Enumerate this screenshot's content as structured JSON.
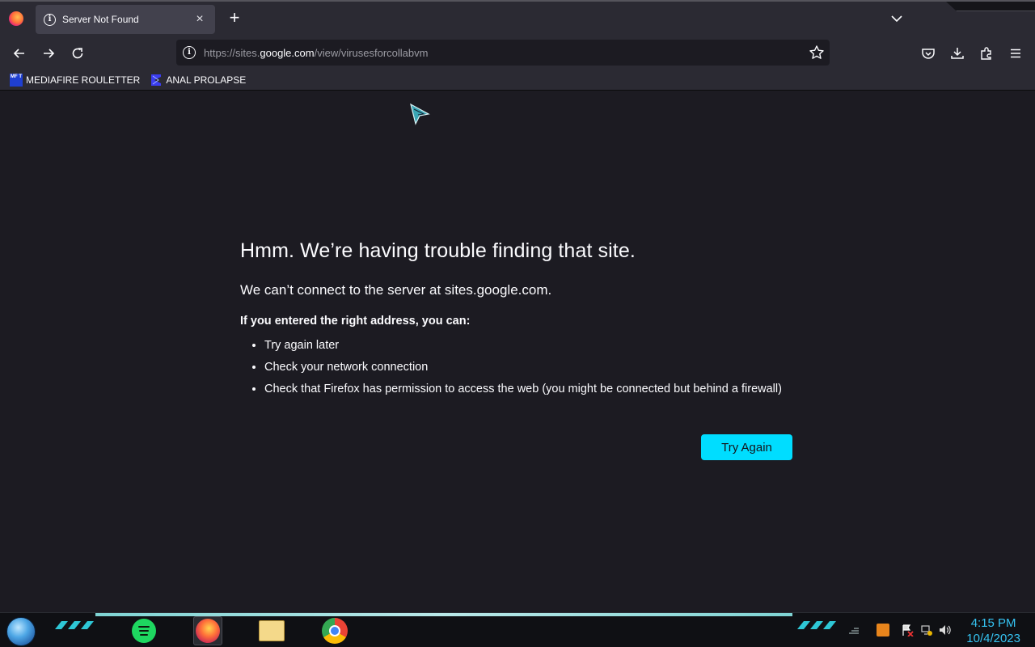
{
  "browser": {
    "tab": {
      "title": "Server Not Found",
      "close_glyph": "×"
    },
    "new_tab_glyph": "+",
    "url": {
      "prefix": "https://sites.",
      "host": "google.com",
      "path": "/view/virusesforcollabvm"
    },
    "bookmarks": [
      {
        "label": "MEDIAFIRE ROULETTER",
        "icon_text": "MF T"
      },
      {
        "label": "ANAL PROLAPSE"
      }
    ]
  },
  "error_page": {
    "title": "Hmm. We’re having trouble finding that site.",
    "subtitle": "We can’t connect to the server at sites.google.com.",
    "hint": "If you entered the right address, you can:",
    "suggestions": [
      "Try again later",
      "Check your network connection",
      "Check that Firefox has permission to access the web (you might be connected but behind a firewall)"
    ],
    "try_again_label": "Try Again"
  },
  "taskbar": {
    "apps": [
      "spotify-icon",
      "firefox-icon",
      "file-explorer-icon",
      "chrome-icon"
    ],
    "clock": {
      "time": "4:15 PM",
      "date": "10/4/2023"
    }
  },
  "colors": {
    "accent": "#00ddff",
    "page_bg": "#1c1b22",
    "toolbar_bg": "#2b2a33",
    "clock": "#35c3f2"
  }
}
